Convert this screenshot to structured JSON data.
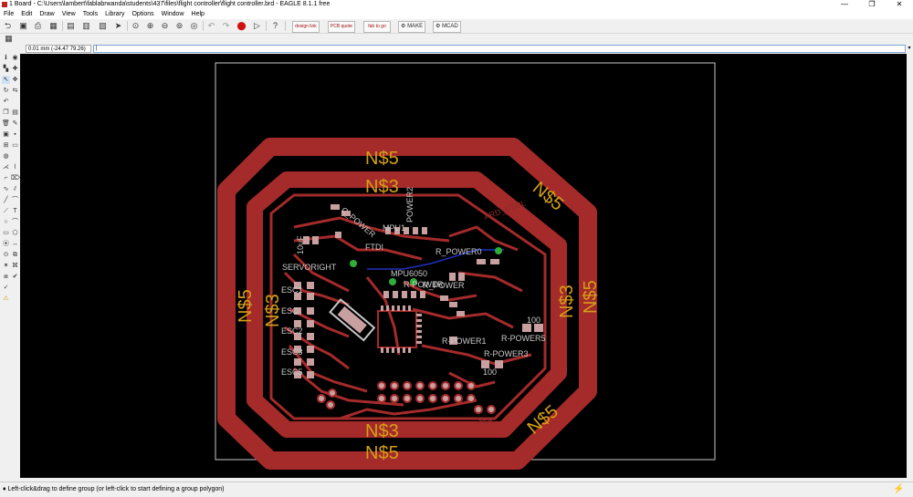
{
  "window": {
    "title": "1 Board - C:\\Users\\lambert\\fablabrwanda\\students\\437\\files\\flight controller\\flight controller.brd - EAGLE 8.1.1 free",
    "minimize": "—",
    "maximize": "❐",
    "close": "✕"
  },
  "menu": [
    "File",
    "Edit",
    "Draw",
    "View",
    "Tools",
    "Library",
    "Options",
    "Window",
    "Help"
  ],
  "toolbar": {
    "help": "?",
    "make_label": "MAKE",
    "mcad_label": "MCAD",
    "badge1": "design link",
    "badge2": "PCB quote",
    "badge3": "fab to go"
  },
  "command": {
    "coordinates": "0.01 mm (-24.47 79.26)",
    "value": "|"
  },
  "status": {
    "message": "♦ Left-click&drag to define group (or left-click to start defining a group polygon)",
    "go_icon": "⚡"
  },
  "colors": {
    "board_bg": "#000000",
    "copper": "#a52a2a",
    "copper_text": "#d4a017",
    "outline": "#c8c8c8",
    "via": "#2fae3a",
    "pad": "#c8a0a0",
    "airwire": "#2030c0"
  },
  "board": {
    "net_labels": {
      "n5_top": "N$5",
      "n3_top": "N$3",
      "n5_right_top": "N$5",
      "n5_left": "N$5",
      "n3_left": "N$3",
      "n3_right": "N$3",
      "n5_right": "N$5",
      "n3_bottom": "N$3",
      "n5_bottom": "N$5",
      "n5_lower_right": "N$5"
    },
    "components": {
      "servoright": "SERVORIGHT",
      "mpu6050": "MPU6050",
      "mpu1": "MPU1",
      "ftdi": "FTDI",
      "r_power": "R_POWER",
      "r_power0": "R_POWER0",
      "r_power1": "R-POWER1",
      "r_power3": "R-POWER3",
      "r_power5": "R-POWER5",
      "c_power": "C_POWER",
      "power2": "POWER2",
      "esc1": "ESC1",
      "esc2": "ESC",
      "esc3": "ESC2",
      "esc4": "ESC3",
      "esc5": "ESC5",
      "val_100a": "100",
      "val_100b": "100",
      "val_10uf": "10uF",
      "ard_label": "ARD_UTOL",
      "mpu_power": "R-POWER",
      "ser": "SER"
    }
  }
}
